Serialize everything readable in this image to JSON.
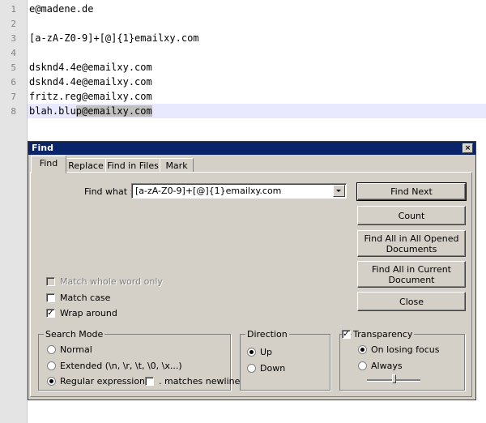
{
  "editor": {
    "lines": [
      {
        "num": "1",
        "text": "e@madene.de"
      },
      {
        "num": "2",
        "text": ""
      },
      {
        "num": "3",
        "text": "[a-zA-Z0-9]+[@]{1}emailxy.com"
      },
      {
        "num": "4",
        "text": ""
      },
      {
        "num": "5",
        "text": "dsknd4.4e@emailxy.com"
      },
      {
        "num": "6",
        "text": "dsknd4.4e@emailxy.com"
      },
      {
        "num": "7",
        "text": "fritz.reg@emailxy.com"
      },
      {
        "num": "8",
        "text_pre": "blah.blu",
        "text_sel": "p@emailxy.com"
      }
    ]
  },
  "dialog": {
    "title": "Find",
    "close_label": "×",
    "tabs": [
      "Find",
      "Replace",
      "Find in Files",
      "Mark"
    ],
    "active_tab": 0,
    "find_what_label": "Find what :",
    "find_what_value": "[a-zA-Z0-9]+[@]{1}emailxy.com",
    "buttons": {
      "find_next": "Find Next",
      "count": "Count",
      "find_all_opened": "Find All in All Opened Documents",
      "find_all_current": "Find All in Current Document",
      "close": "Close"
    },
    "options": {
      "match_whole_word": {
        "label": "Match whole word only",
        "checked": false,
        "enabled": false
      },
      "match_case": {
        "label": "Match case",
        "checked": false
      },
      "wrap_around": {
        "label": "Wrap around",
        "checked": true
      }
    },
    "search_mode": {
      "legend": "Search Mode",
      "normal": "Normal",
      "extended": "Extended (\\n, \\r, \\t, \\0, \\x...)",
      "regex": "Regular expression",
      "matches_newline": ". matches newline",
      "selected": "regex"
    },
    "direction": {
      "legend": "Direction",
      "up": "Up",
      "down": "Down",
      "selected": "up"
    },
    "transparency": {
      "label": "Transparency",
      "checked": true,
      "on_losing_focus": "On losing focus",
      "always": "Always",
      "selected": "on_losing_focus",
      "level": 0.5
    }
  }
}
